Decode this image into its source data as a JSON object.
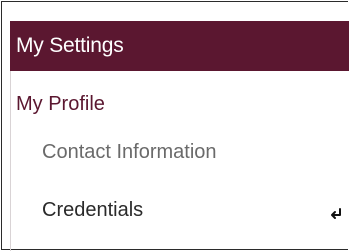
{
  "header": {
    "title": "My Settings"
  },
  "menu": {
    "section_title": "My Profile",
    "items": [
      {
        "label": "Contact Information"
      },
      {
        "label": "Credentials",
        "icon": "enter-key-icon"
      }
    ]
  },
  "colors": {
    "header_bg": "#5b1730",
    "section_title": "#5b1730",
    "muted_text": "#6a6a6a",
    "text": "#2a2a2a"
  }
}
